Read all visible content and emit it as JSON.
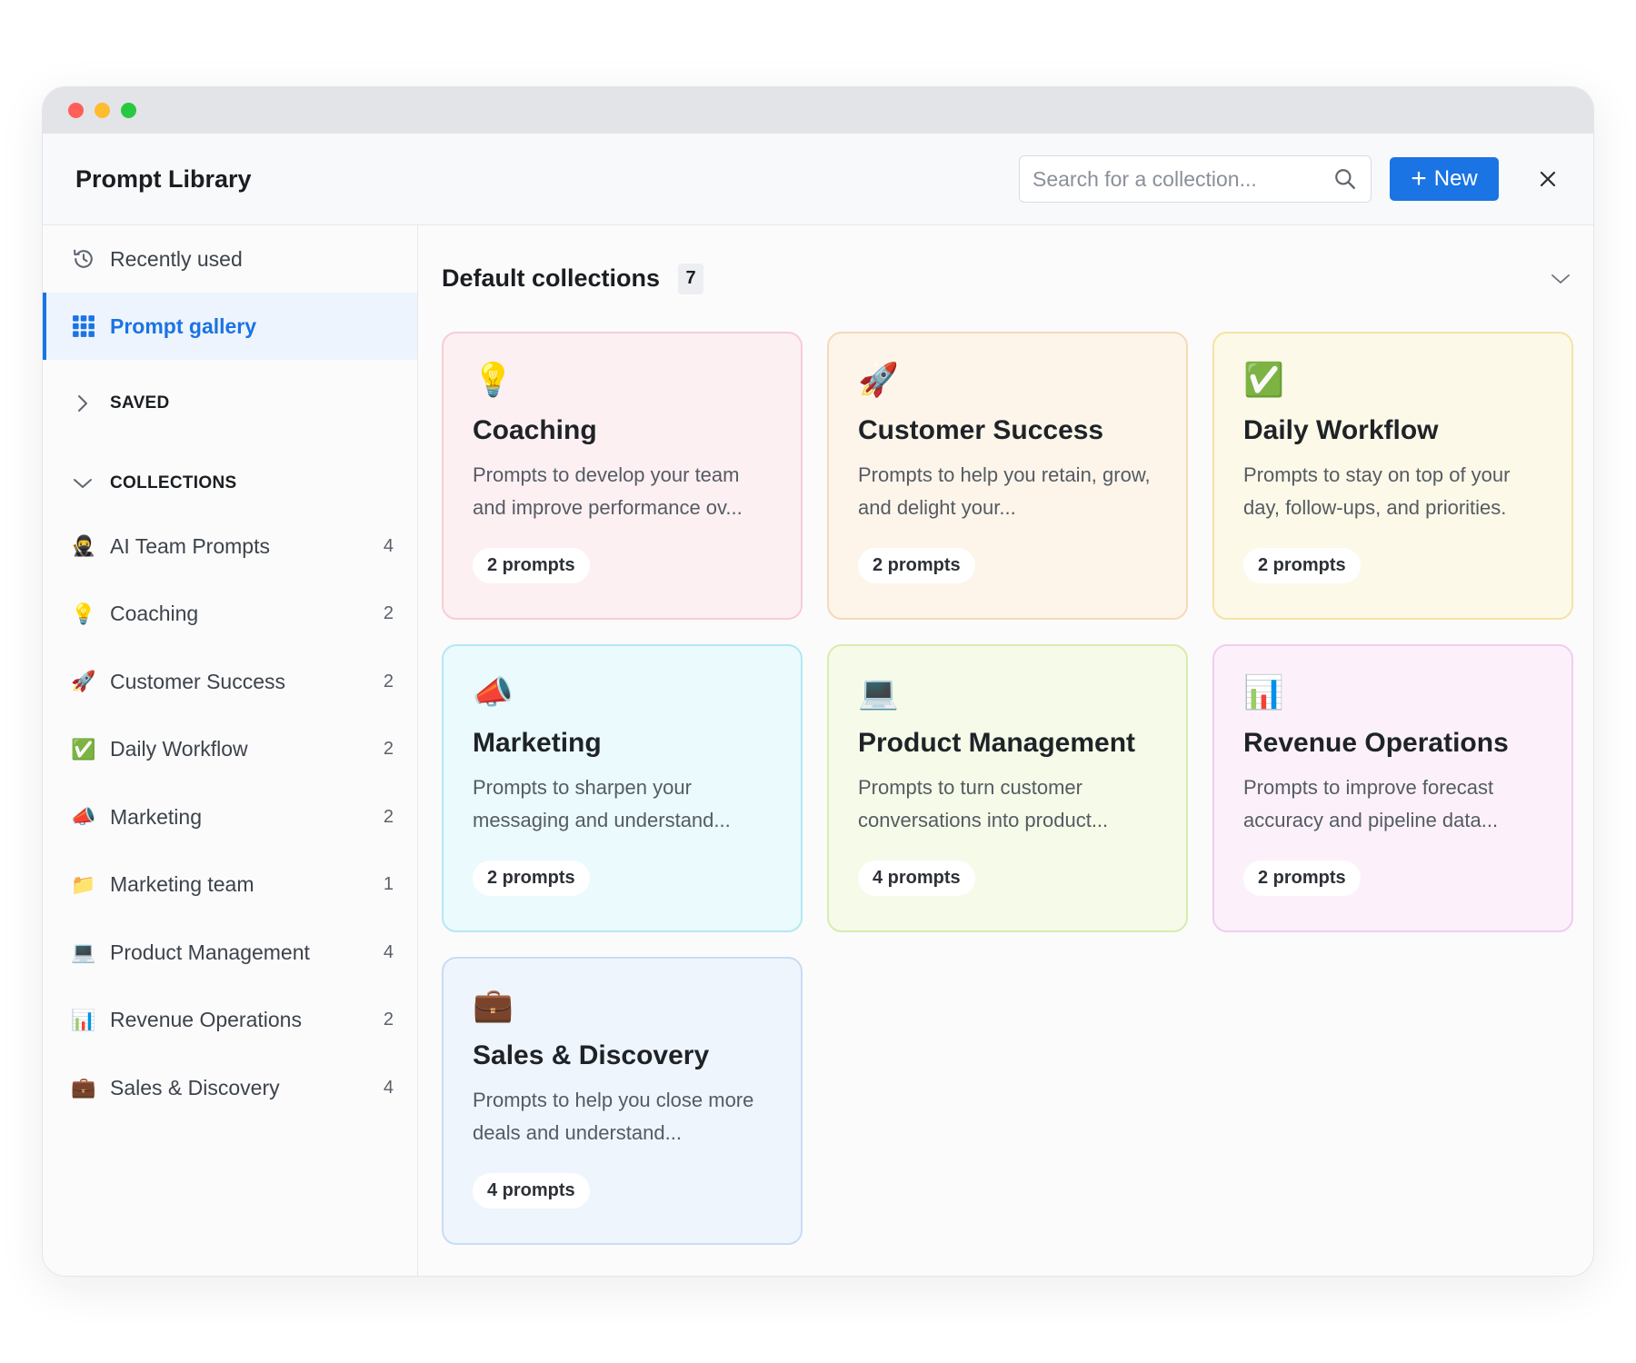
{
  "app": {
    "title": "Prompt Library"
  },
  "header": {
    "search_placeholder": "Search for a collection...",
    "new_label": "New"
  },
  "sidebar": {
    "recent_label": "Recently used",
    "gallery_label": "Prompt gallery",
    "saved_label": "SAVED",
    "collections_label": "COLLECTIONS",
    "collections": [
      {
        "icon": "🥷",
        "label": "AI Team Prompts",
        "count": "4"
      },
      {
        "icon": "💡",
        "label": "Coaching",
        "count": "2"
      },
      {
        "icon": "🚀",
        "label": "Customer Success",
        "count": "2"
      },
      {
        "icon": "✅",
        "label": "Daily Workflow",
        "count": "2"
      },
      {
        "icon": "📣",
        "label": "Marketing",
        "count": "2"
      },
      {
        "icon": "📁",
        "label": "Marketing team",
        "count": "1"
      },
      {
        "icon": "💻",
        "label": "Product Management",
        "count": "4"
      },
      {
        "icon": "📊",
        "label": "Revenue Operations",
        "count": "2"
      },
      {
        "icon": "💼",
        "label": "Sales & Discovery",
        "count": "4"
      }
    ]
  },
  "main": {
    "title": "Default collections",
    "count": "7",
    "cards": [
      {
        "icon": "💡",
        "title": "Coaching",
        "desc": "Prompts to develop your team and improve performance ov...",
        "badge": "2 prompts"
      },
      {
        "icon": "🚀",
        "title": "Customer Success",
        "desc": "Prompts to help you retain, grow, and delight your...",
        "badge": "2 prompts"
      },
      {
        "icon": "✅",
        "title": "Daily Workflow",
        "desc": "Prompts to stay on top of your day, follow-ups, and priorities.",
        "badge": "2 prompts"
      },
      {
        "icon": "📣",
        "title": "Marketing",
        "desc": "Prompts to sharpen your messaging and understand...",
        "badge": "2 prompts"
      },
      {
        "icon": "💻",
        "title": "Product Management",
        "desc": "Prompts to turn customer conversations into product...",
        "badge": "4 prompts"
      },
      {
        "icon": "📊",
        "title": "Revenue Operations",
        "desc": "Prompts to improve forecast accuracy and pipeline data...",
        "badge": "2 prompts"
      },
      {
        "icon": "💼",
        "title": "Sales & Discovery",
        "desc": "Prompts to help you close more deals and understand...",
        "badge": "4 prompts"
      }
    ]
  },
  "colors": {
    "accent": "#1a74e4"
  }
}
